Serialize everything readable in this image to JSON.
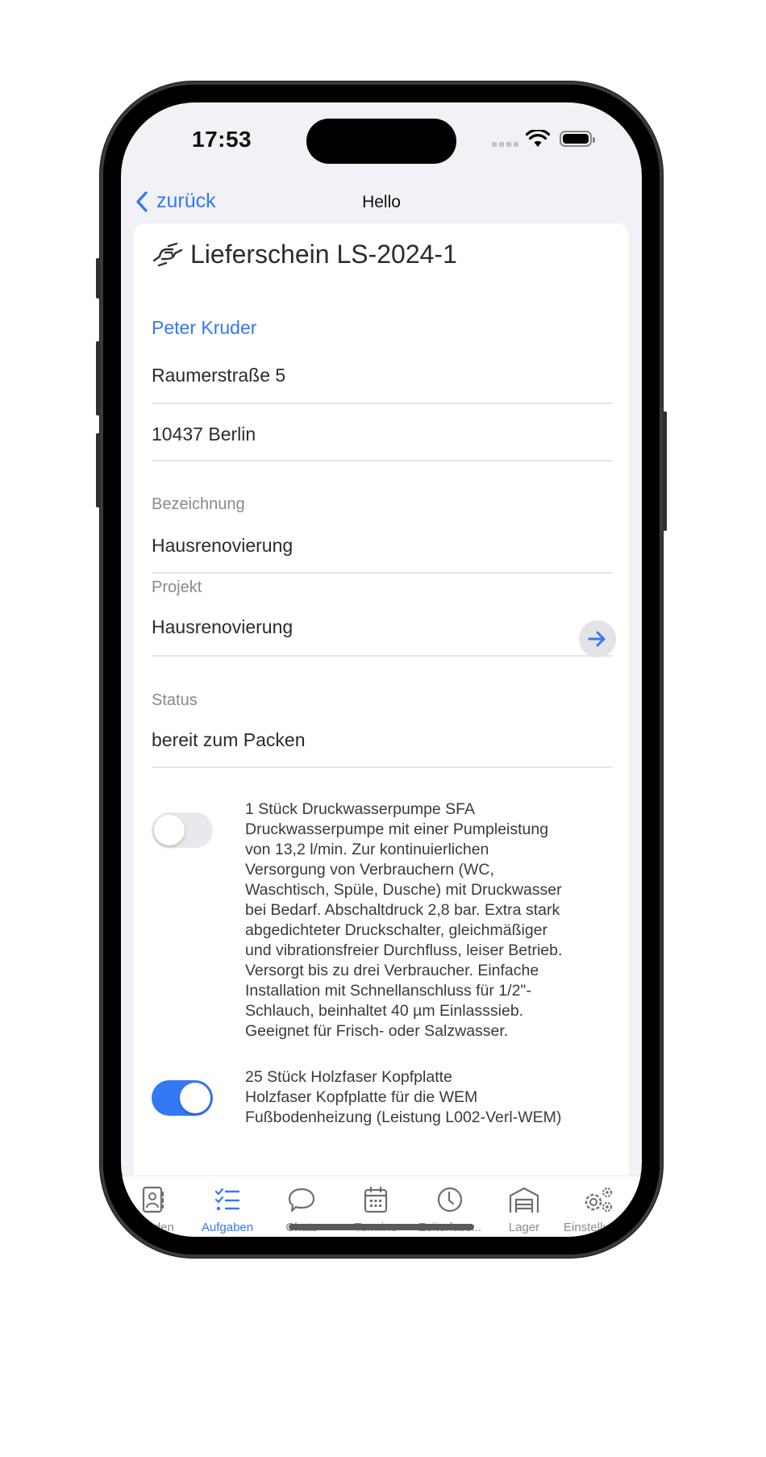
{
  "status_bar": {
    "time": "17:53"
  },
  "nav": {
    "back_label": "zurück",
    "title": "Hello"
  },
  "document": {
    "title": "Lieferschein LS-2024-1",
    "icon": "handshake-icon",
    "customer": {
      "name": "Peter Kruder",
      "street": "Raumerstraße 5",
      "city": "10437 Berlin"
    },
    "fields": {
      "bezeichnung_label": "Bezeichnung",
      "bezeichnung_value": "Hausrenovierung",
      "projekt_label": "Projekt",
      "projekt_value": "Hausrenovierung",
      "status_label": "Status",
      "status_value": "bereit zum Packen"
    },
    "items": [
      {
        "checked": false,
        "text": "1 Stück Druckwasserpumpe SFA\nDruckwasserpumpe mit einer Pumpleistung\nvon 13,2 l/min. Zur kontinuierlichen\nVersorgung von Verbrauchern (WC,\nWaschtisch, Spüle, Dusche) mit Druckwasser\nbei Bedarf. Abschaltdruck 2,8 bar. Extra stark\nabgedichteter Druckschalter, gleichmäßiger\nund vibrationsfreier Durchfluss, leiser Betrieb.\nVersorgt bis zu drei Verbraucher. Einfache\nInstallation mit Schnellanschluss für 1/2\"-\nSchlauch, beinhaltet 40 µm Einlasssieb.\nGeeignet für Frisch- oder Salzwasser."
      },
      {
        "checked": true,
        "text": "25 Stück Holzfaser Kopfplatte\nHolzfaser Kopfplatte für die WEM\nFußbodenheizung (Leistung L002-Verl-WEM)"
      }
    ]
  },
  "tabbar": {
    "active": "Aufgaben",
    "tabs": [
      {
        "label": "Kunden",
        "icon": "contacts-book-icon"
      },
      {
        "label": "Aufgaben",
        "icon": "checklist-icon"
      },
      {
        "label": "Chats",
        "icon": "chat-bubble-icon"
      },
      {
        "label": "Termine",
        "icon": "calendar-icon"
      },
      {
        "label": "Zeiterfass...",
        "icon": "clock-icon"
      },
      {
        "label": "Lager",
        "icon": "warehouse-icon"
      },
      {
        "label": "Einstellung...",
        "icon": "gears-icon"
      }
    ]
  },
  "colors": {
    "accent": "#3478f6",
    "secondary_text": "#8a8a8e",
    "background": "#f1f1f6"
  }
}
